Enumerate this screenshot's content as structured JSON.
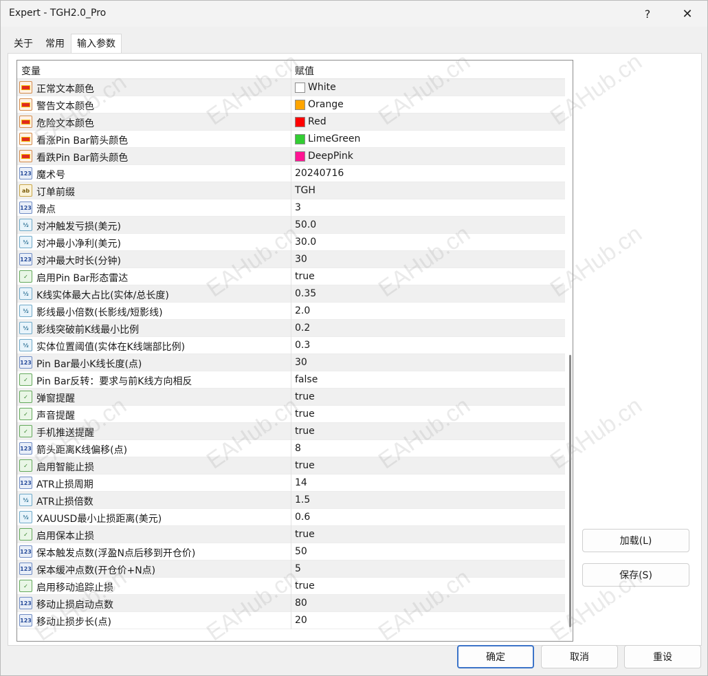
{
  "window": {
    "title": "Expert - TGH2.0_Pro",
    "help_glyph": "?",
    "close_glyph": "✕"
  },
  "tabs": [
    {
      "label": "关于"
    },
    {
      "label": "常用"
    },
    {
      "label": "输入参数",
      "active": true
    }
  ],
  "table": {
    "headers": {
      "variable": "变量",
      "value": "赋值"
    },
    "rows": [
      {
        "type": "color",
        "name": "正常文本颜色",
        "value": "White",
        "swatch": "#ffffff"
      },
      {
        "type": "color",
        "name": "警告文本颜色",
        "value": "Orange",
        "swatch": "#ffa500"
      },
      {
        "type": "color",
        "name": "危险文本颜色",
        "value": "Red",
        "swatch": "#ff0000"
      },
      {
        "type": "color",
        "name": "看涨Pin Bar箭头颜色",
        "value": "LimeGreen",
        "swatch": "#32cd32"
      },
      {
        "type": "color",
        "name": "看跌Pin Bar箭头颜色",
        "value": "DeepPink",
        "swatch": "#ff1493"
      },
      {
        "type": "int",
        "name": "魔术号",
        "value": "20240716"
      },
      {
        "type": "string",
        "name": "订单前缀",
        "value": "TGH"
      },
      {
        "type": "int",
        "name": "滑点",
        "value": "3"
      },
      {
        "type": "double",
        "name": "对冲触发亏损(美元)",
        "value": "50.0"
      },
      {
        "type": "double",
        "name": "对冲最小净利(美元)",
        "value": "30.0"
      },
      {
        "type": "int",
        "name": "对冲最大时长(分钟)",
        "value": "30"
      },
      {
        "type": "bool",
        "name": "启用Pin Bar形态雷达",
        "value": "true"
      },
      {
        "type": "double",
        "name": "K线实体最大占比(实体/总长度)",
        "value": "0.35"
      },
      {
        "type": "double",
        "name": "影线最小倍数(长影线/短影线)",
        "value": "2.0"
      },
      {
        "type": "double",
        "name": "影线突破前K线最小比例",
        "value": "0.2"
      },
      {
        "type": "double",
        "name": "实体位置阈值(实体在K线端部比例)",
        "value": "0.3"
      },
      {
        "type": "int",
        "name": "Pin Bar最小K线长度(点)",
        "value": "30"
      },
      {
        "type": "bool",
        "name": "Pin Bar反转：要求与前K线方向相反",
        "value": "false"
      },
      {
        "type": "bool",
        "name": "弹窗提醒",
        "value": "true"
      },
      {
        "type": "bool",
        "name": "声音提醒",
        "value": "true"
      },
      {
        "type": "bool",
        "name": "手机推送提醒",
        "value": "true"
      },
      {
        "type": "int",
        "name": "箭头距离K线偏移(点)",
        "value": "8"
      },
      {
        "type": "bool",
        "name": "启用智能止损",
        "value": "true"
      },
      {
        "type": "int",
        "name": "ATR止损周期",
        "value": "14"
      },
      {
        "type": "double",
        "name": "ATR止损倍数",
        "value": "1.5"
      },
      {
        "type": "double",
        "name": "XAUUSD最小止损距离(美元)",
        "value": "0.6"
      },
      {
        "type": "bool",
        "name": "启用保本止损",
        "value": "true"
      },
      {
        "type": "int",
        "name": "保本触发点数(浮盈N点后移到开仓价)",
        "value": "50"
      },
      {
        "type": "int",
        "name": "保本缓冲点数(开仓价+N点)",
        "value": "5"
      },
      {
        "type": "bool",
        "name": "启用移动追踪止损",
        "value": "true"
      },
      {
        "type": "int",
        "name": "移动止损启动点数",
        "value": "80"
      },
      {
        "type": "int",
        "name": "移动止损步长(点)",
        "value": "20"
      }
    ]
  },
  "side_buttons": {
    "load": "加载(L)",
    "save": "保存(S)"
  },
  "footer_buttons": {
    "ok": "确定",
    "cancel": "取消",
    "reset": "重设"
  },
  "icon_glyphs": {
    "int": "123",
    "double": "½",
    "bool": "✓",
    "string": "ab",
    "color": ""
  },
  "watermark": "EAHub.cn"
}
